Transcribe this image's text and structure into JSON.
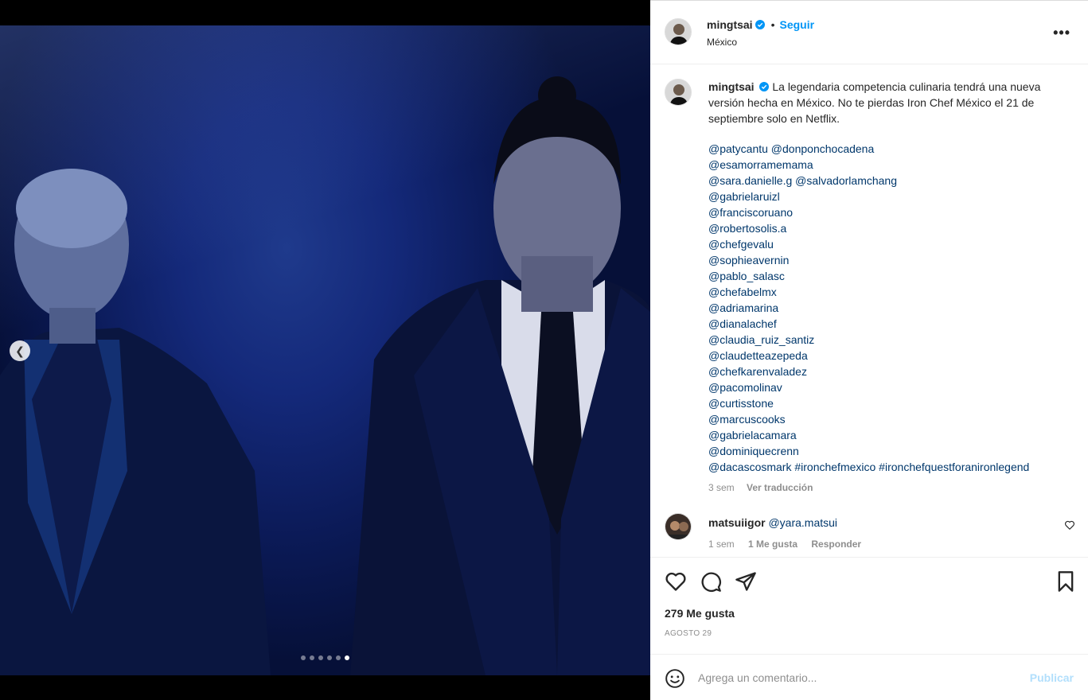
{
  "post": {
    "media": {
      "prev_icon": "chevron-left-icon",
      "carousel_count": 6,
      "carousel_active": 6
    },
    "header": {
      "username": "mingtsai",
      "separator": "•",
      "follow_label": "Seguir",
      "location": "México",
      "more_label": "•••"
    },
    "caption": {
      "username": "mingtsai",
      "text": "La legendaria competencia culinaria tendrá una nueva versión hecha en México. No te pierdas Iron Chef México el 21 de septiembre solo en Netflix.",
      "mentions": [
        "@patycantu @donponchocadena",
        "@esamorramemama",
        "@sara.danielle.g @salvadorlamchang",
        "@gabrielaruizl",
        "@franciscoruano",
        "@robertosolis.a",
        "@chefgevalu",
        "@sophieavernin",
        "@pablo_salasc",
        "@chefabelmx",
        "@adriamarina",
        "@dianalachef",
        "@claudia_ruiz_santiz",
        "@claudetteazepeda",
        "@chefkarenvaladez",
        "@pacomolinav",
        "@curtisstone",
        "@marcuscooks",
        "@gabrielacamara",
        "@dominiquecrenn",
        "@dacascosmark #ironchefmexico #ironchefquestforanironlegend"
      ],
      "time": "3 sem",
      "translate_label": "Ver traducción"
    },
    "comment": {
      "username": "matsuiigor",
      "text": "@yara.matsui",
      "time": "1 sem",
      "likes": "1 Me gusta",
      "reply_label": "Responder"
    },
    "actions": {
      "likes": "279 Me gusta",
      "date": "AGOSTO 29"
    },
    "add_comment": {
      "placeholder": "Agrega un comentario...",
      "publish_label": "Publicar"
    },
    "colors": {
      "accent": "#0095f6",
      "mention": "#00376b",
      "publish_disabled": "#b2dffc",
      "muted": "#8e8e8e"
    }
  }
}
